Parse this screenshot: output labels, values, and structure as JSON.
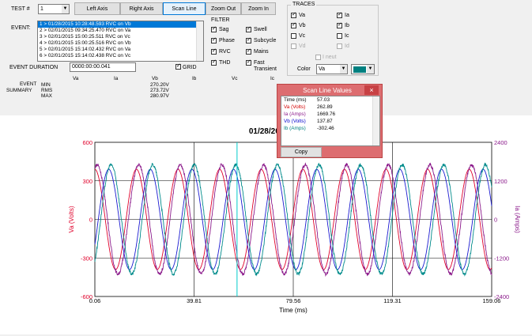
{
  "toolbar": {
    "test_label": "TEST #",
    "test_value": "1",
    "left_axis": "Left Axis",
    "right_axis": "Right Axis",
    "scan_line": "Scan Line",
    "zoom_out": "Zoom Out",
    "zoom_in": "Zoom In"
  },
  "event": {
    "label": "EVENT:",
    "items": [
      "1 > 01/28/2015 10:28:48.593  RVC  on  Vb",
      "2 > 02/01/2015 09:34:25.470  RVC  on  Va",
      "3 > 02/01/2015 15:00:25.511  RVC  on  Vc",
      "4 > 02/01/2015 15:00:25.516  RVC  on  Vb",
      "5 > 02/01/2015 15:14:02.432  RVC  on  Va",
      "6 > 02/01/2015 15:14:02.438  RVC  on  Vc"
    ],
    "duration_label": "EVENT DURATION",
    "duration_value": "0000:00:00.041",
    "grid_label": "GRID"
  },
  "filter": {
    "title": "FILTER",
    "items": [
      "Sag",
      "Swell",
      "Phase",
      "Subcycle",
      "RVC",
      "Mains",
      "THD",
      "Fast Transient"
    ]
  },
  "traces": {
    "title": "TRACES",
    "items": [
      "Va",
      "Ia",
      "Vb",
      "Ib",
      "Vc",
      "Ic",
      "Vd",
      "Id"
    ],
    "ineut": "I neut",
    "color_label": "Color",
    "color_value": "Va",
    "swatch_color": "#008080"
  },
  "summary": {
    "label1": "EVENT",
    "label2": "SUMMARY",
    "headers": [
      "Va",
      "Ia",
      "Vb",
      "Ib",
      "Vc",
      "Ic"
    ],
    "rows": [
      "MIN",
      "RMS",
      "MAX"
    ],
    "vb_values": [
      "270.20V",
      "273.72V",
      "280.97V"
    ]
  },
  "popup": {
    "title": "Scan Line Values",
    "close": "×",
    "rows": [
      {
        "label": "Time (ms)",
        "value": "57.03",
        "color": "#000000"
      },
      {
        "label": "Va (Volts)",
        "value": "262.89",
        "color": "#d40000"
      },
      {
        "label": "Ia (Amps)",
        "value": "1669.76",
        "color": "#8b1a8b"
      },
      {
        "label": "Vb (Volts)",
        "value": "137.87",
        "color": "#0000cc"
      },
      {
        "label": "Ib (Amps)",
        "value": "-302.46",
        "color": "#008080"
      }
    ],
    "copy": "Copy"
  },
  "chart_data": {
    "type": "line",
    "title": "01/28/2015 10:28:48.537",
    "xlabel": "Time (ms)",
    "ylabel_left": "Va (Volts)",
    "ylabel_right": "Ia (Amps)",
    "x_ticks": [
      "0.06",
      "39.81",
      "79.56",
      "119.31",
      "159.06"
    ],
    "y_left_ticks": [
      "600",
      "300",
      "0",
      "-300",
      "-600"
    ],
    "y_right_ticks": [
      "2400",
      "1200",
      "0",
      "-1200",
      "-2400"
    ],
    "xlim": [
      0.06,
      159.06
    ],
    "ylim_left": [
      -600,
      600
    ],
    "ylim_right": [
      -2400,
      2400
    ],
    "grid": true,
    "scan_line_x": 57.03,
    "series": [
      {
        "name": "Va",
        "color": "#e0002a",
        "axis": "left",
        "amplitude": 390,
        "phase_deg": 0
      },
      {
        "name": "Ia",
        "color": "#8b1a8b",
        "axis": "right",
        "amplitude": 1700,
        "phase_deg": -20
      },
      {
        "name": "Vb",
        "color": "#1a1ad0",
        "axis": "left",
        "amplitude": 390,
        "phase_deg": -120
      },
      {
        "name": "Ib",
        "color": "#008b8b",
        "axis": "right",
        "amplitude": 1700,
        "phase_deg": -140
      }
    ],
    "frequency_hz": 60
  }
}
